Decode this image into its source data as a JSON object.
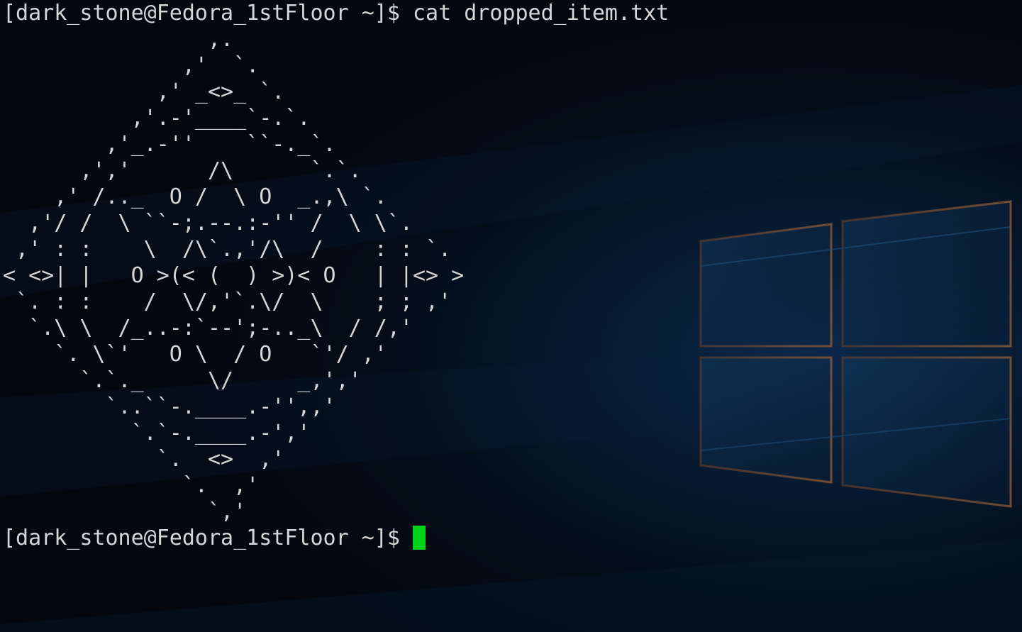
{
  "terminal": {
    "prompt": "[dark_stone@Fedora_1stFloor ~]$",
    "command": "cat dropped_item.txt",
    "output_lines": [
      "                ,.",
      "              ,'  `.",
      "            ,' _<>_ `.",
      "          ,'.-'____`-.`.",
      "        ,'_.-''    ``-._`.",
      "      ,','      /\\      `.`.",
      "    ,' /.._  O /  \\ O  _.,\\ `.",
      "  ,'/ /  \\ ``-;.--.:-'' /  \\ \\`.",
      " ,' : :    \\  /\\`.,'/\\  /    : : `.",
      "< <>| |   O >(< (  ) >)< O   | |<> >",
      " `. : :    /  \\/,'`.\\/  \\    ; ; ,'",
      "  `.\\ \\  /_..-:`--';-.._\\  / /,'",
      "    `. \\`'   O \\  / O   `'/ ,'",
      "      `.`._     \\/     _,','",
      "        `..``-.____.-'',,'",
      "          `.`-.____.-','",
      "            `.  <>  ,'",
      "              `.  ,'",
      "                `,'"
    ],
    "cursor_color": "#00d21a",
    "text_color": "#d6d6d6",
    "background_color": "#03080f"
  }
}
